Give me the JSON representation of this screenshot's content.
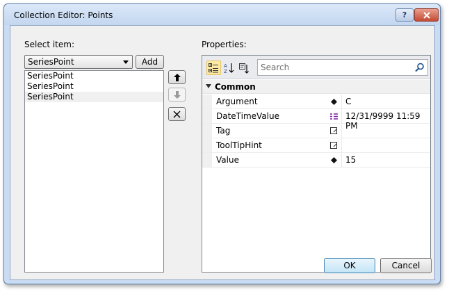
{
  "window": {
    "title": "Collection Editor: Points"
  },
  "titlebar": {
    "help_label": "?"
  },
  "left": {
    "select_label": "Select item:",
    "combo_value": "SeriesPoint",
    "add_label": "Add",
    "items": [
      {
        "label": "SeriesPoint"
      },
      {
        "label": "SeriesPoint"
      },
      {
        "label": "SeriesPoint"
      }
    ]
  },
  "properties": {
    "label": "Properties:",
    "search_placeholder": "Search",
    "category": "Common",
    "rows": [
      {
        "name": "Argument",
        "value": "C",
        "icon": "diamond-icon"
      },
      {
        "name": "DateTimeValue",
        "value": "12/31/9999 11:59 PM",
        "icon": "datetime-icon"
      },
      {
        "name": "Tag",
        "value": "",
        "icon": "edit-box-icon"
      },
      {
        "name": "ToolTipHint",
        "value": "",
        "icon": "edit-box-icon"
      },
      {
        "name": "Value",
        "value": "15",
        "icon": "diamond-icon"
      }
    ]
  },
  "buttons": {
    "ok": "OK",
    "cancel": "Cancel"
  }
}
